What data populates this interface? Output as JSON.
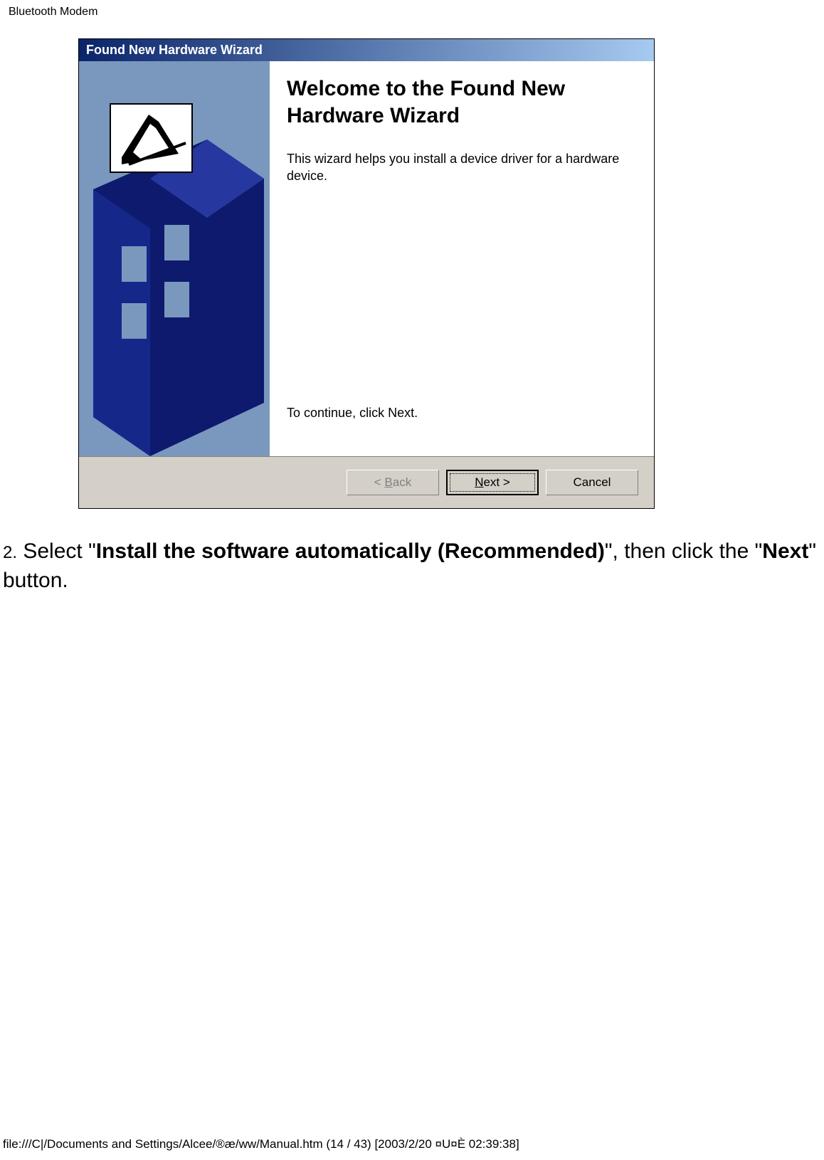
{
  "page": {
    "header": "Bluetooth Modem",
    "footer": "file:///C|/Documents and Settings/Alcee/®æ/ww/Manual.htm (14 / 43) [2003/2/20 ¤U¤È 02:39:38]"
  },
  "wizard": {
    "title": "Found New Hardware Wizard",
    "heading": "Welcome to the Found New Hardware Wizard",
    "description": "This wizard helps you install a device driver for a hardware device.",
    "continueText": "To continue, click Next.",
    "buttons": {
      "back": "< Back",
      "next": "Next >",
      "cancel": "Cancel"
    }
  },
  "instruction": {
    "stepNum": "2.",
    "prefix": " Select \"",
    "bold1": "Install the software automatically (Recommended)",
    "mid": "\", then click the \"",
    "bold2": "Next",
    "suffix": "\" button."
  }
}
